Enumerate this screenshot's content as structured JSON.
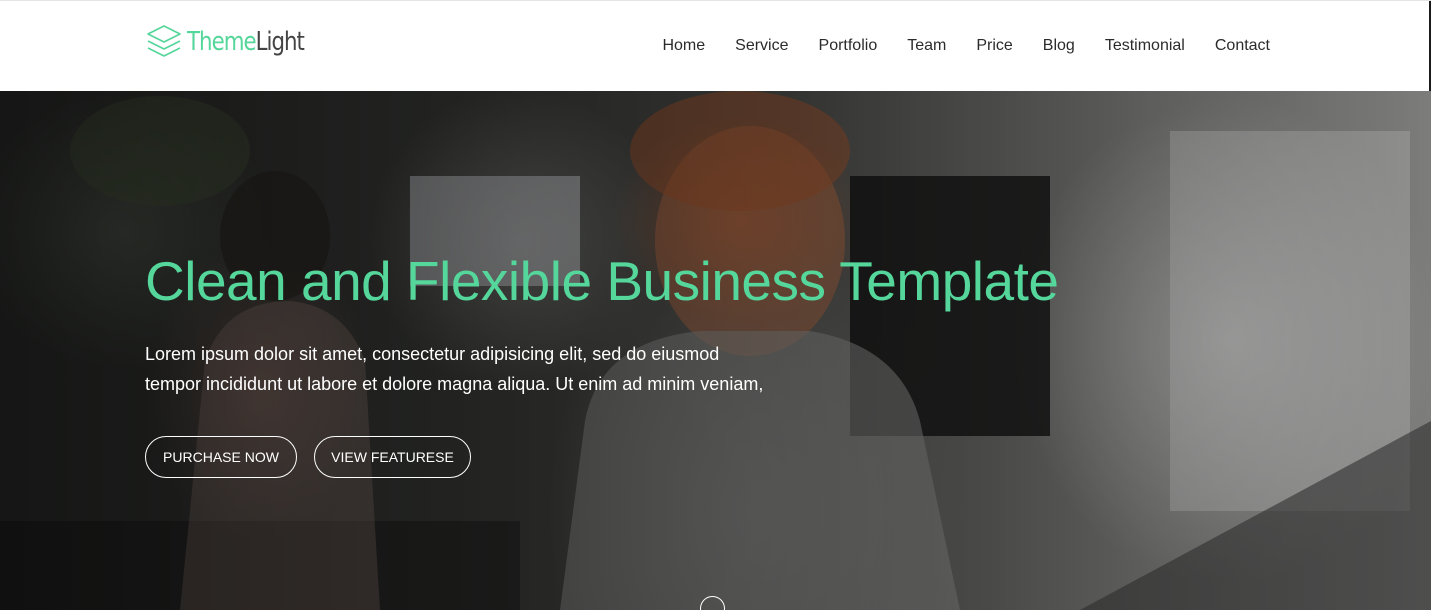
{
  "brand": {
    "name_part1": "Theme",
    "name_part2": "Light",
    "accent_color": "#55d69a"
  },
  "nav": {
    "items": [
      "Home",
      "Service",
      "Portfolio",
      "Team",
      "Price",
      "Blog",
      "Testimonial",
      "Contact"
    ]
  },
  "hero": {
    "title": "Clean and Flexible Business Template",
    "text_line1": "Lorem ipsum dolor sit amet, consectetur adipisicing elit, sed do eiusmod",
    "text_line2": "tempor incididunt ut labore et dolore magna aliqua. Ut enim ad minim veniam,",
    "buttons": {
      "purchase": "PURCHASE NOW",
      "features": "VIEW FEATURESE"
    },
    "background": "office-photo",
    "scroll_icon": "scroll-down-circle-icon"
  }
}
